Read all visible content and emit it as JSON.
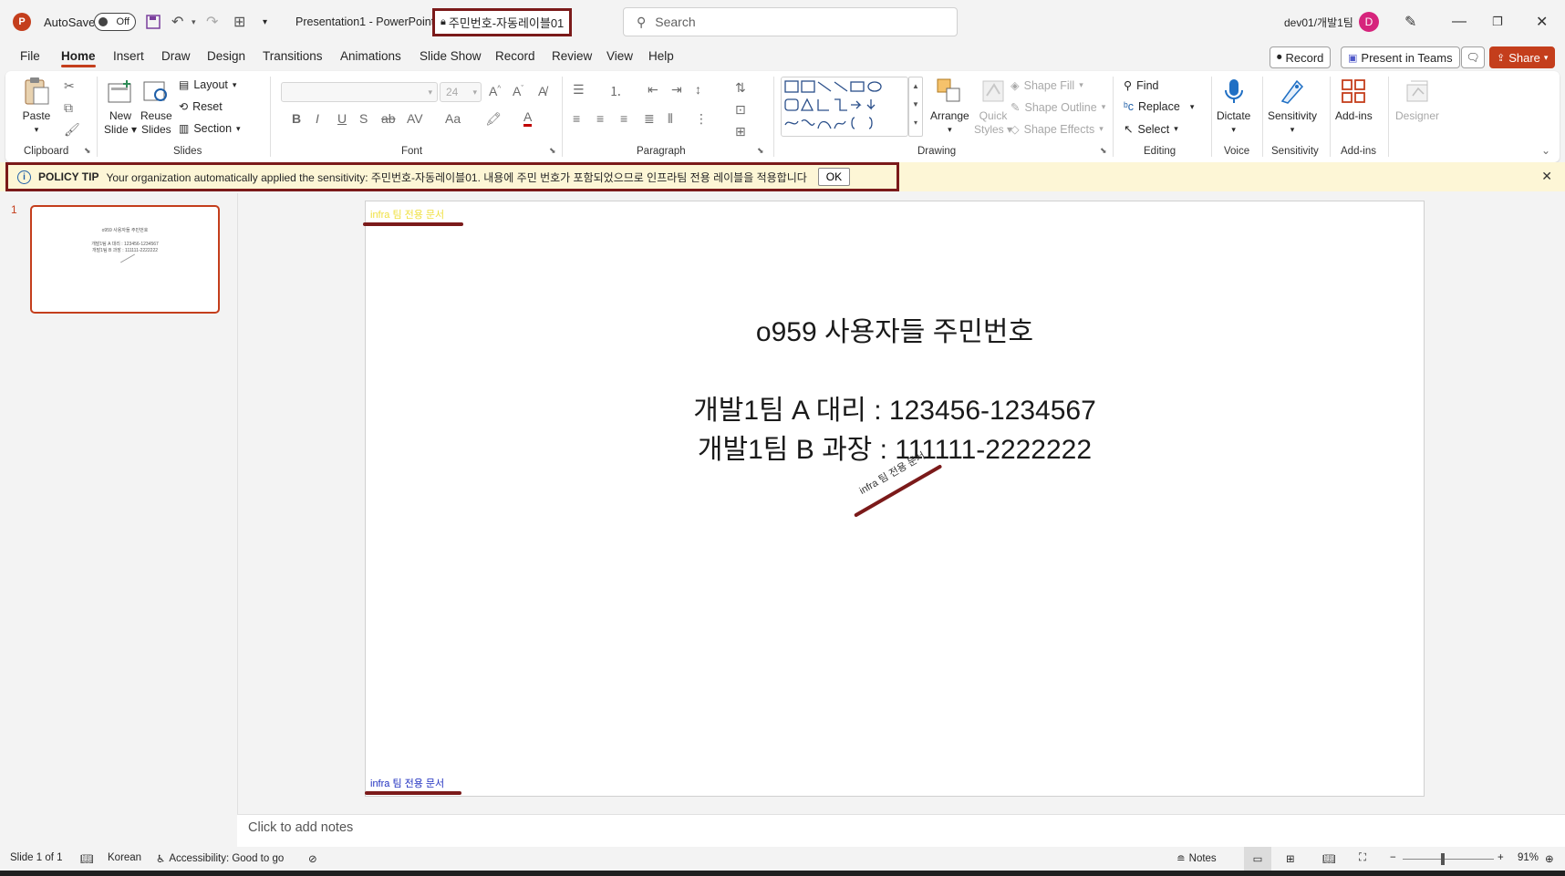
{
  "titlebar": {
    "autosave_label": "AutoSave",
    "autosave_state": "Off",
    "doc_title": "Presentation1  -  PowerPoint",
    "sensitivity_label": "주민번호-자동레이블01",
    "search_placeholder": "Search",
    "account_name": "dev01/개발1팀",
    "avatar_initial": "D"
  },
  "tabs": [
    "File",
    "Home",
    "Insert",
    "Draw",
    "Design",
    "Transitions",
    "Animations",
    "Slide Show",
    "Record",
    "Review",
    "View",
    "Help"
  ],
  "tab_actions": {
    "record": "Record",
    "present_teams": "Present in Teams",
    "share": "Share"
  },
  "ribbon": {
    "clipboard": {
      "label": "Clipboard",
      "paste": "Paste"
    },
    "slides": {
      "label": "Slides",
      "new_slide_1": "New",
      "new_slide_2": "Slide",
      "reuse_1": "Reuse",
      "reuse_2": "Slides",
      "layout": "Layout",
      "reset": "Reset",
      "section": "Section"
    },
    "font": {
      "label": "Font",
      "size": "24"
    },
    "paragraph": {
      "label": "Paragraph"
    },
    "drawing": {
      "label": "Drawing",
      "arrange": "Arrange",
      "quick_1": "Quick",
      "quick_2": "Styles",
      "shape_fill": "Shape Fill",
      "shape_outline": "Shape Outline",
      "shape_effects": "Shape Effects"
    },
    "editing": {
      "label": "Editing",
      "find": "Find",
      "replace": "Replace",
      "select": "Select"
    },
    "voice": {
      "label": "Voice",
      "dictate": "Dictate"
    },
    "sensitivity": {
      "label": "Sensitivity",
      "button": "Sensitivity"
    },
    "addins": {
      "label": "Add-ins",
      "button": "Add-ins"
    },
    "designer": {
      "button": "Designer"
    }
  },
  "policy_tip": {
    "title": "POLICY TIP",
    "message": "Your organization automatically applied the sensitivity: 주민번호-자동레이블01. 내용에 주민 번호가 포함되었으므로 인프라팀 전용 레이블을 적용합니다",
    "ok": "OK"
  },
  "thumbnails": [
    {
      "number": "1",
      "title": "o959 사용자들 주민번호",
      "line1": "개발1팀 A 대리 : 123456-1234567",
      "line2": "개발1팀 B 과장 : 111111-2222222"
    }
  ],
  "slide": {
    "header_label": "infra 팀 전용 문서",
    "title": "o959 사용자들 주민번호",
    "line1": "개발1팀 A 대리 : 123456-1234567",
    "line2": "개발1팀 B 과장 : 111111-2222222",
    "watermark": "infra 팀 전용 문서",
    "footer_label": "infra 팀 전용 문서"
  },
  "notes_placeholder": "Click to add notes",
  "statusbar": {
    "slide_info": "Slide 1 of 1",
    "language": "Korean",
    "accessibility": "Accessibility: Good to go",
    "notes": "Notes",
    "zoom": "91%"
  },
  "colors": {
    "accent": "#c43e1c",
    "highlight_border": "#7b1a1a",
    "policy_bg": "#fdf6d6",
    "header_label": "#f0e040",
    "footer_label": "#2030c0"
  }
}
